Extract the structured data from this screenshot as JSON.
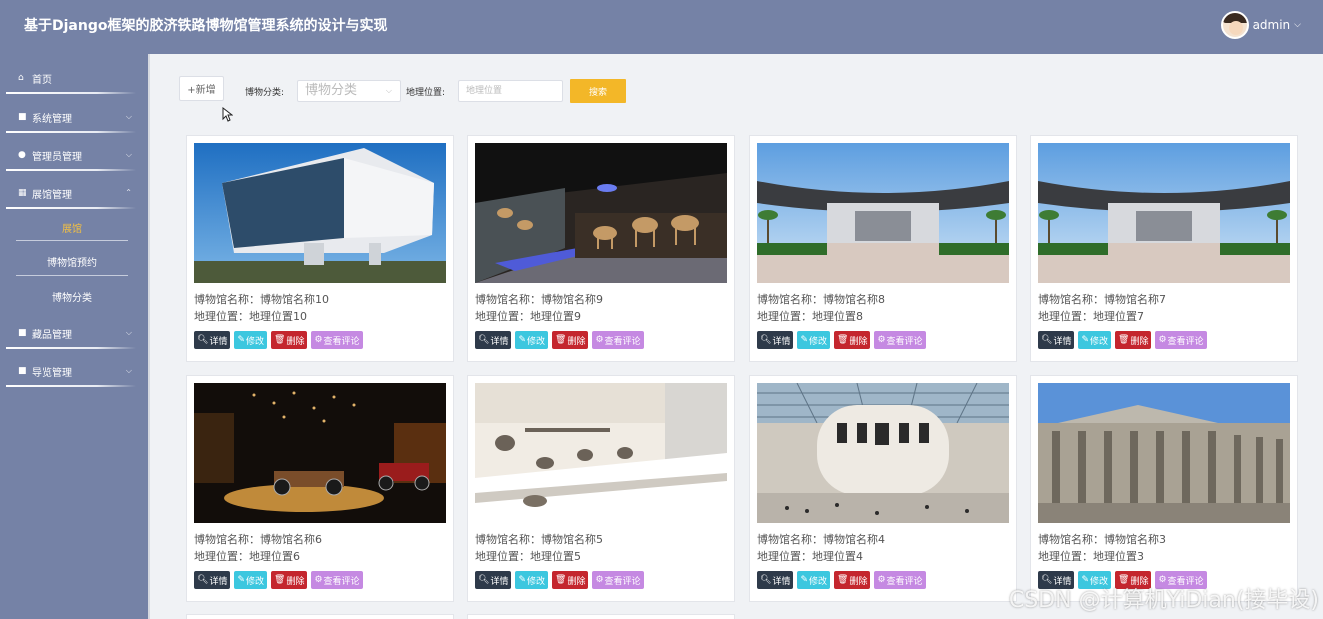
{
  "header": {
    "title": "基于Django框架的胶济铁路博物馆管理系统的设计与实现",
    "username": "admin"
  },
  "sidebar": {
    "items": [
      {
        "label": "首页",
        "icon": "home-icon"
      },
      {
        "label": "系统管理",
        "icon": "grid-icon"
      },
      {
        "label": "管理员管理",
        "icon": "user-icon"
      },
      {
        "label": "展馆管理",
        "icon": "apps-icon"
      },
      {
        "label": "藏品管理",
        "icon": "grid-icon"
      },
      {
        "label": "导览管理",
        "icon": "grid-icon"
      }
    ],
    "sub_items": [
      {
        "label": "展馆"
      },
      {
        "label": "博物馆预约"
      },
      {
        "label": "博物分类"
      }
    ]
  },
  "toolbar": {
    "add_label": "+新增",
    "category_label": "博物分类:",
    "category_placeholder": "博物分类",
    "location_label": "地理位置:",
    "location_placeholder": "地理位置",
    "search_label": "搜索"
  },
  "card_buttons": {
    "detail": "详情",
    "edit": "修改",
    "delete": "删除",
    "comments": "查看评论"
  },
  "cards": [
    {
      "name_line": "博物馆名称：博物馆名称10",
      "location_line": "地理位置：地理位置10"
    },
    {
      "name_line": "博物馆名称：博物馆名称9",
      "location_line": "地理位置：地理位置9"
    },
    {
      "name_line": "博物馆名称：博物馆名称8",
      "location_line": "地理位置：地理位置8"
    },
    {
      "name_line": "博物馆名称：博物馆名称7",
      "location_line": "地理位置：地理位置7"
    },
    {
      "name_line": "博物馆名称：博物馆名称6",
      "location_line": "地理位置：地理位置6"
    },
    {
      "name_line": "博物馆名称：博物馆名称5",
      "location_line": "地理位置：地理位置5"
    },
    {
      "name_line": "博物馆名称：博物馆名称4",
      "location_line": "地理位置：地理位置4"
    },
    {
      "name_line": "博物馆名称：博物馆名称3",
      "location_line": "地理位置：地理位置3"
    }
  ],
  "watermark": "CSDN @计算机YiDian(接毕设)"
}
